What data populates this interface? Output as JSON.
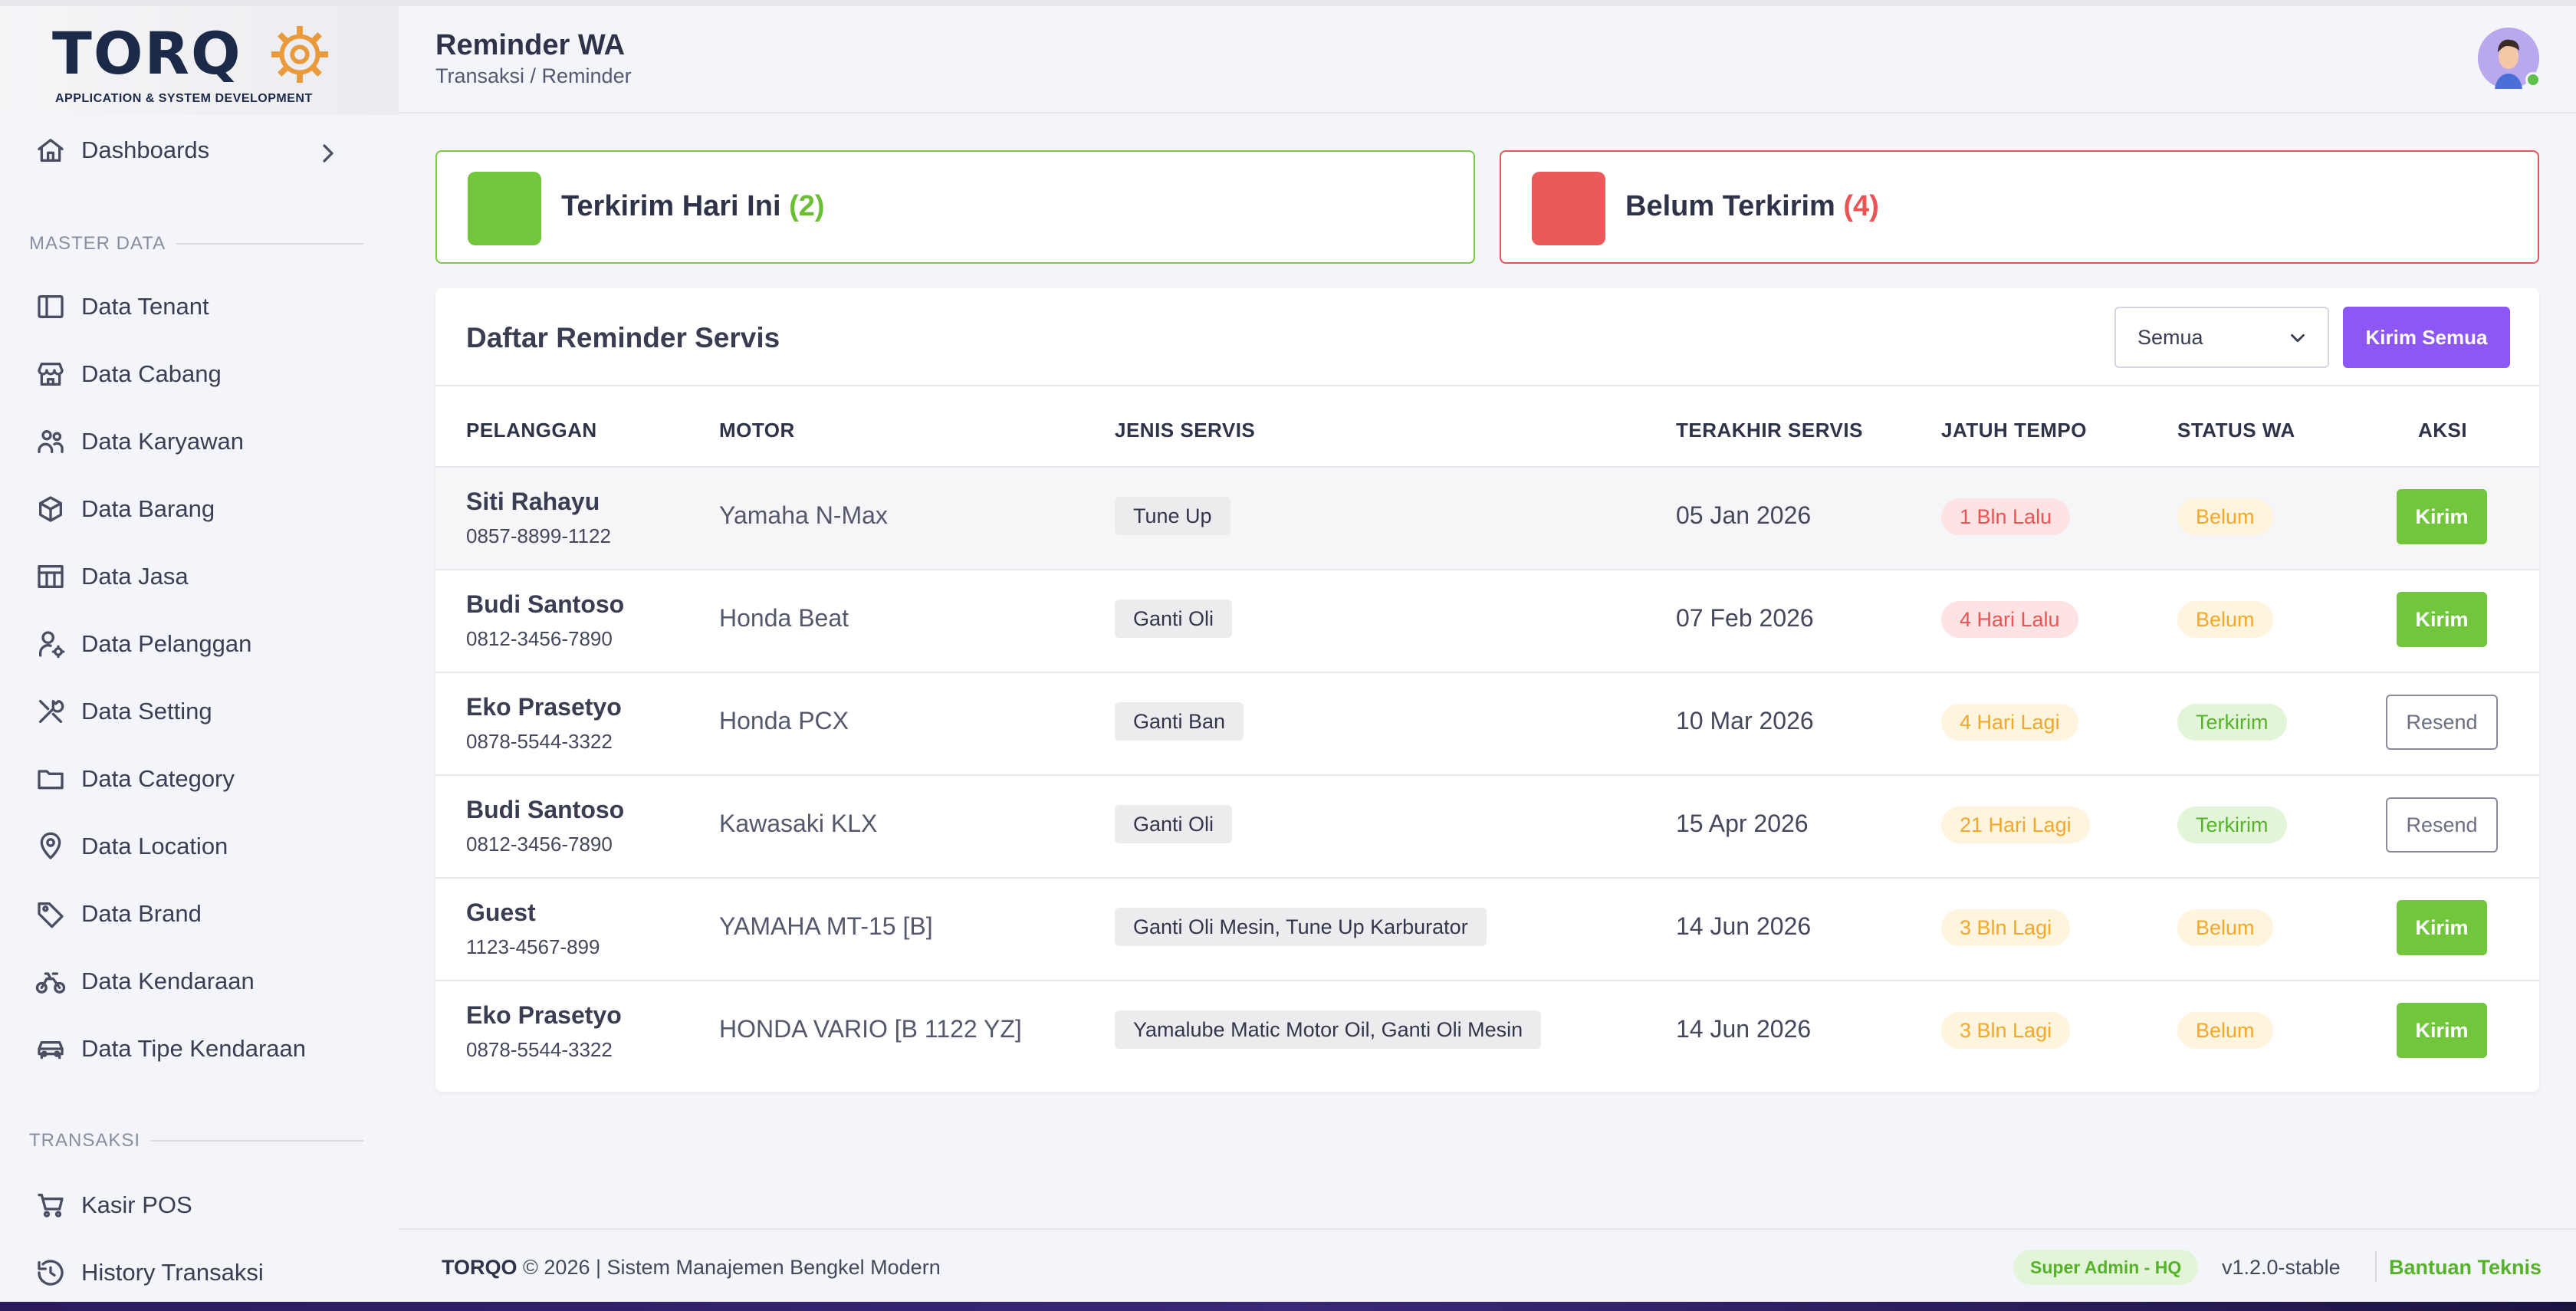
{
  "brand": {
    "name": "TORQ",
    "tagline": "APPLICATION & SYSTEM DEVELOPMENT",
    "accent": "#e89a3c"
  },
  "sidebar": {
    "dashboards": "Dashboards",
    "section_master": "MASTER DATA",
    "master_items": [
      {
        "label": "Data Tenant",
        "icon": "sidebar-panel-icon"
      },
      {
        "label": "Data Cabang",
        "icon": "store-icon"
      },
      {
        "label": "Data Karyawan",
        "icon": "users-icon"
      },
      {
        "label": "Data Barang",
        "icon": "box-icon"
      },
      {
        "label": "Data Jasa",
        "icon": "layout-icon"
      },
      {
        "label": "Data Pelanggan",
        "icon": "user-cog-icon"
      },
      {
        "label": "Data Setting",
        "icon": "tools-icon"
      },
      {
        "label": "Data Category",
        "icon": "folder-icon"
      },
      {
        "label": "Data Location",
        "icon": "map-pin-icon"
      },
      {
        "label": "Data Brand",
        "icon": "tag-icon"
      },
      {
        "label": "Data Kendaraan",
        "icon": "bike-icon"
      },
      {
        "label": "Data Tipe Kendaraan",
        "icon": "car-icon"
      }
    ],
    "section_transaksi": "TRANSAKSI",
    "transaksi_items": [
      {
        "label": "Kasir POS",
        "icon": "cart-icon"
      },
      {
        "label": "History Transaksi",
        "icon": "history-icon"
      }
    ]
  },
  "header": {
    "title": "Reminder WA",
    "breadcrumb": "Transaksi / Reminder"
  },
  "stats": {
    "sent_label": "Terkirim Hari Ini",
    "sent_count": "(2)",
    "unsent_label": "Belum Terkirim",
    "unsent_count": "(4)",
    "colors": {
      "green": "#71c63c",
      "red": "#ea5455"
    }
  },
  "table": {
    "title": "Daftar Reminder Servis",
    "filter_value": "Semua",
    "send_all_label": "Kirim Semua",
    "columns": [
      "PELANGGAN",
      "MOTOR",
      "JENIS SERVIS",
      "TERAKHIR SERVIS",
      "JATUH TEMPO",
      "STATUS WA",
      "AKSI"
    ],
    "rows": [
      {
        "name": "Siti Rahayu",
        "phone": "0857-8899-1122",
        "motor": "Yamaha N-Max",
        "jenis": "Tune Up",
        "last": "05 Jan 2026",
        "tempo": "1 Bln Lalu",
        "tempo_kind": "red",
        "status": "Belum",
        "status_kind": "belum",
        "action": "Kirim",
        "action_kind": "kirim"
      },
      {
        "name": "Budi Santoso",
        "phone": "0812-3456-7890",
        "motor": "Honda Beat",
        "jenis": "Ganti Oli",
        "last": "07 Feb 2026",
        "tempo": "4 Hari Lalu",
        "tempo_kind": "red",
        "status": "Belum",
        "status_kind": "belum",
        "action": "Kirim",
        "action_kind": "kirim"
      },
      {
        "name": "Eko Prasetyo",
        "phone": "0878-5544-3322",
        "motor": "Honda PCX",
        "jenis": "Ganti Ban",
        "last": "10 Mar 2026",
        "tempo": "4 Hari Lagi",
        "tempo_kind": "yellow",
        "status": "Terkirim",
        "status_kind": "terkirim",
        "action": "Resend",
        "action_kind": "resend"
      },
      {
        "name": "Budi Santoso",
        "phone": "0812-3456-7890",
        "motor": "Kawasaki KLX",
        "jenis": "Ganti Oli",
        "last": "15 Apr 2026",
        "tempo": "21 Hari Lagi",
        "tempo_kind": "yellow",
        "status": "Terkirim",
        "status_kind": "terkirim",
        "action": "Resend",
        "action_kind": "resend"
      },
      {
        "name": "Guest",
        "phone": "1123-4567-899",
        "motor": "YAMAHA MT-15 [B]",
        "jenis": "Ganti Oli Mesin, Tune Up Karburator",
        "last": "14 Jun 2026",
        "tempo": "3 Bln Lagi",
        "tempo_kind": "yellow",
        "status": "Belum",
        "status_kind": "belum",
        "action": "Kirim",
        "action_kind": "kirim"
      },
      {
        "name": "Eko Prasetyo",
        "phone": "0878-5544-3322",
        "motor": "HONDA VARIO [B 1122 YZ]",
        "jenis": "Yamalube Matic Motor Oil, Ganti Oli Mesin",
        "last": "14 Jun 2026",
        "tempo": "3 Bln Lagi",
        "tempo_kind": "yellow",
        "status": "Belum",
        "status_kind": "belum",
        "action": "Kirim",
        "action_kind": "kirim"
      }
    ]
  },
  "footer": {
    "brand": "TORQO",
    "text": " © 2026 | Sistem Manajemen Bengkel Modern",
    "role_badge": "Super Admin - HQ",
    "version": "v1.2.0-stable",
    "help": "Bantuan Teknis"
  }
}
